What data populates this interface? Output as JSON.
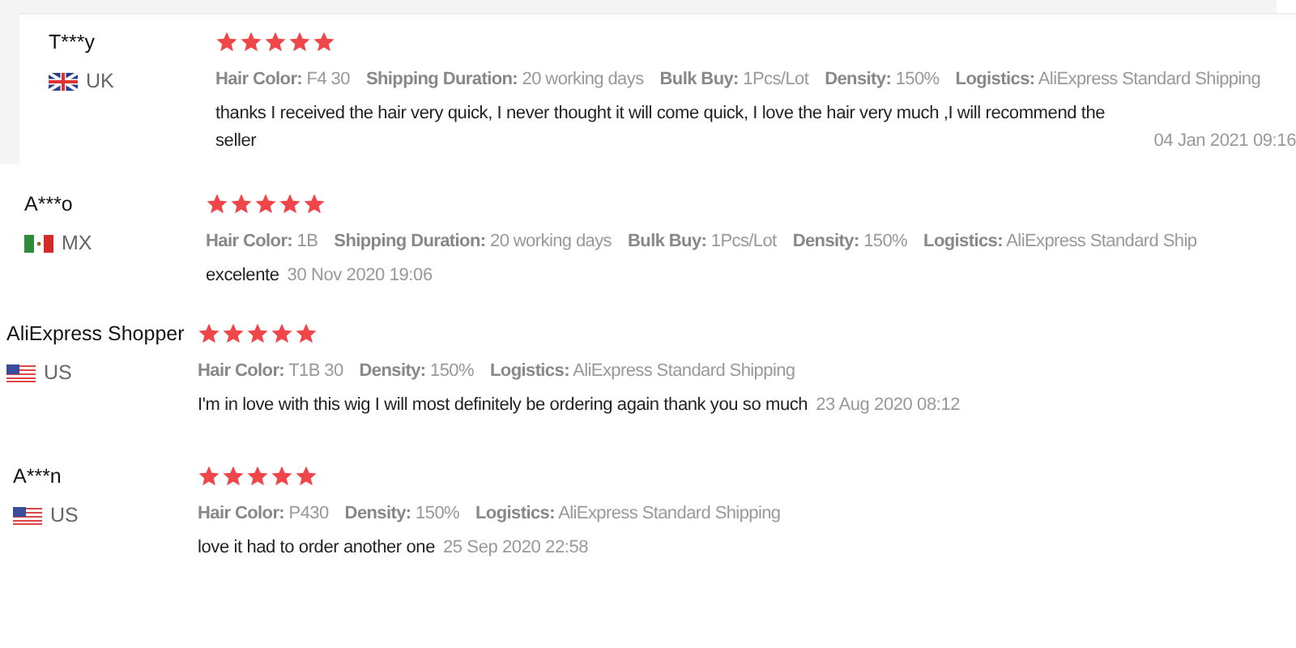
{
  "reviews": [
    {
      "name": "T***y",
      "kind": "uk",
      "country": "UK",
      "stars": 5,
      "attributes": [
        {
          "label": "Hair Color:",
          "value": "F4 30"
        },
        {
          "label": "Shipping Duration:",
          "value": "20 working days"
        },
        {
          "label": "Bulk Buy:",
          "value": "1Pcs/Lot"
        },
        {
          "label": "Density:",
          "value": "150%"
        },
        {
          "label": "Logistics:",
          "value": "AliExpress Standard Shipping"
        }
      ],
      "comment": "thanks I received the hair very quick, I never thought it will come quick, I love the hair very much ,I will recommend the seller",
      "date": "04 Jan 2021 09:16"
    },
    {
      "name": "A***o",
      "kind": "mx",
      "country": "MX",
      "stars": 5,
      "attributes": [
        {
          "label": "Hair Color:",
          "value": "1B"
        },
        {
          "label": "Shipping Duration:",
          "value": "20 working days"
        },
        {
          "label": "Bulk Buy:",
          "value": "1Pcs/Lot"
        },
        {
          "label": "Density:",
          "value": "150%"
        },
        {
          "label": "Logistics:",
          "value": "AliExpress Standard Ship"
        }
      ],
      "comment": "excelente",
      "date": "30 Nov 2020 19:06"
    },
    {
      "name": "AliExpress Shopper",
      "kind": "us",
      "country": "US",
      "stars": 5,
      "attributes": [
        {
          "label": "Hair Color:",
          "value": "T1B 30"
        },
        {
          "label": "Density:",
          "value": "150%"
        },
        {
          "label": "Logistics:",
          "value": "AliExpress Standard Shipping"
        }
      ],
      "comment": "I'm in love with this wig I will most definitely be ordering again thank you so much",
      "date": "23 Aug 2020 08:12"
    },
    {
      "name": "A***n",
      "kind": "us",
      "country": "US",
      "stars": 5,
      "attributes": [
        {
          "label": "Hair Color:",
          "value": "P430"
        },
        {
          "label": "Density:",
          "value": "150%"
        },
        {
          "label": "Logistics:",
          "value": "AliExpress Standard Shipping"
        }
      ],
      "comment": "love it had to order another one",
      "date": "25 Sep 2020 22:58"
    }
  ]
}
